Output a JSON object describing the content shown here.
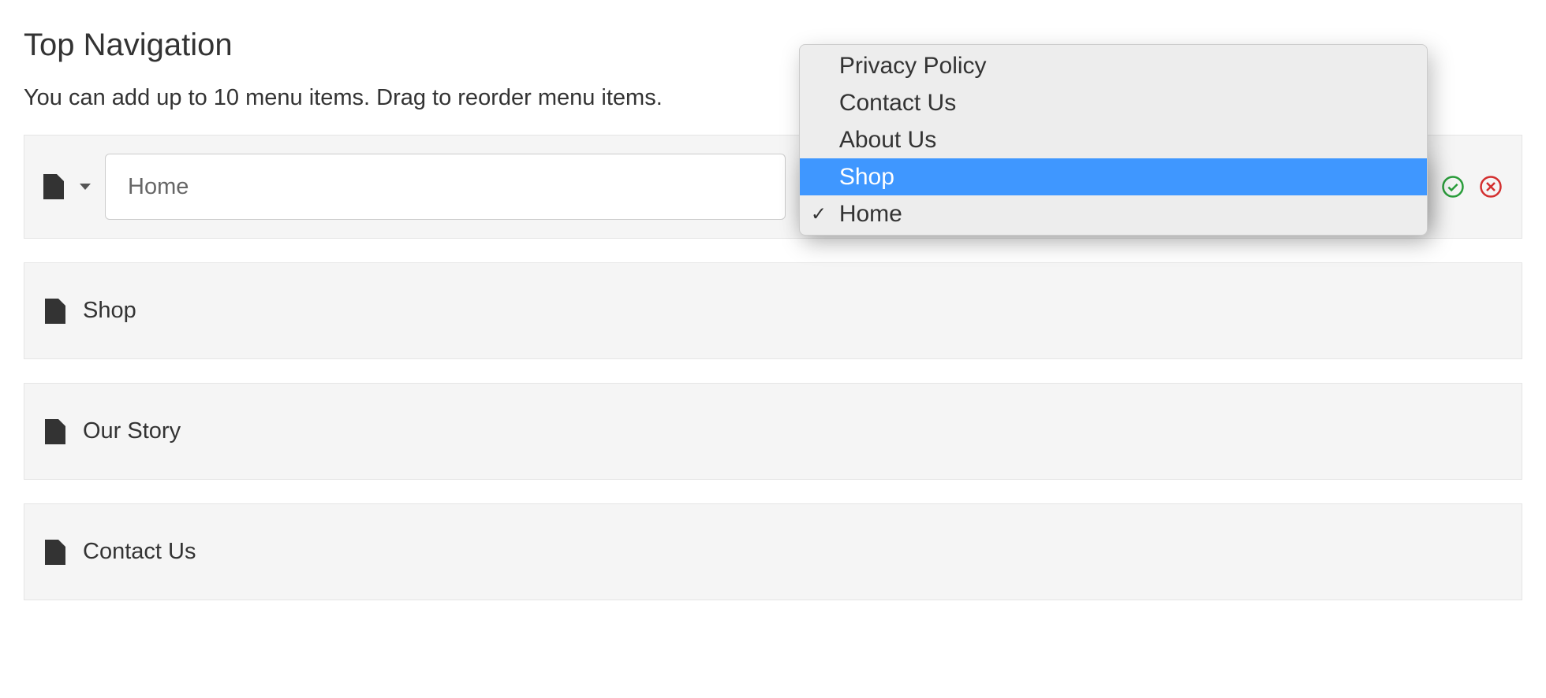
{
  "header": {
    "title": "Top Navigation",
    "subtitle": "You can add up to 10 menu items. Drag to reorder menu items."
  },
  "edit_row": {
    "name_value": "Home",
    "select_value": "Home"
  },
  "dropdown": {
    "options": [
      {
        "label": "Privacy Policy",
        "highlighted": false,
        "checked": false
      },
      {
        "label": "Contact Us",
        "highlighted": false,
        "checked": false
      },
      {
        "label": "About Us",
        "highlighted": false,
        "checked": false
      },
      {
        "label": "Shop",
        "highlighted": true,
        "checked": false
      },
      {
        "label": "Home",
        "highlighted": false,
        "checked": true
      }
    ]
  },
  "items": [
    {
      "label": "Shop"
    },
    {
      "label": "Our Story"
    },
    {
      "label": "Contact Us"
    }
  ],
  "colors": {
    "highlight": "#3f97ff",
    "confirm": "#2a9d3b",
    "cancel": "#d32f2f"
  }
}
